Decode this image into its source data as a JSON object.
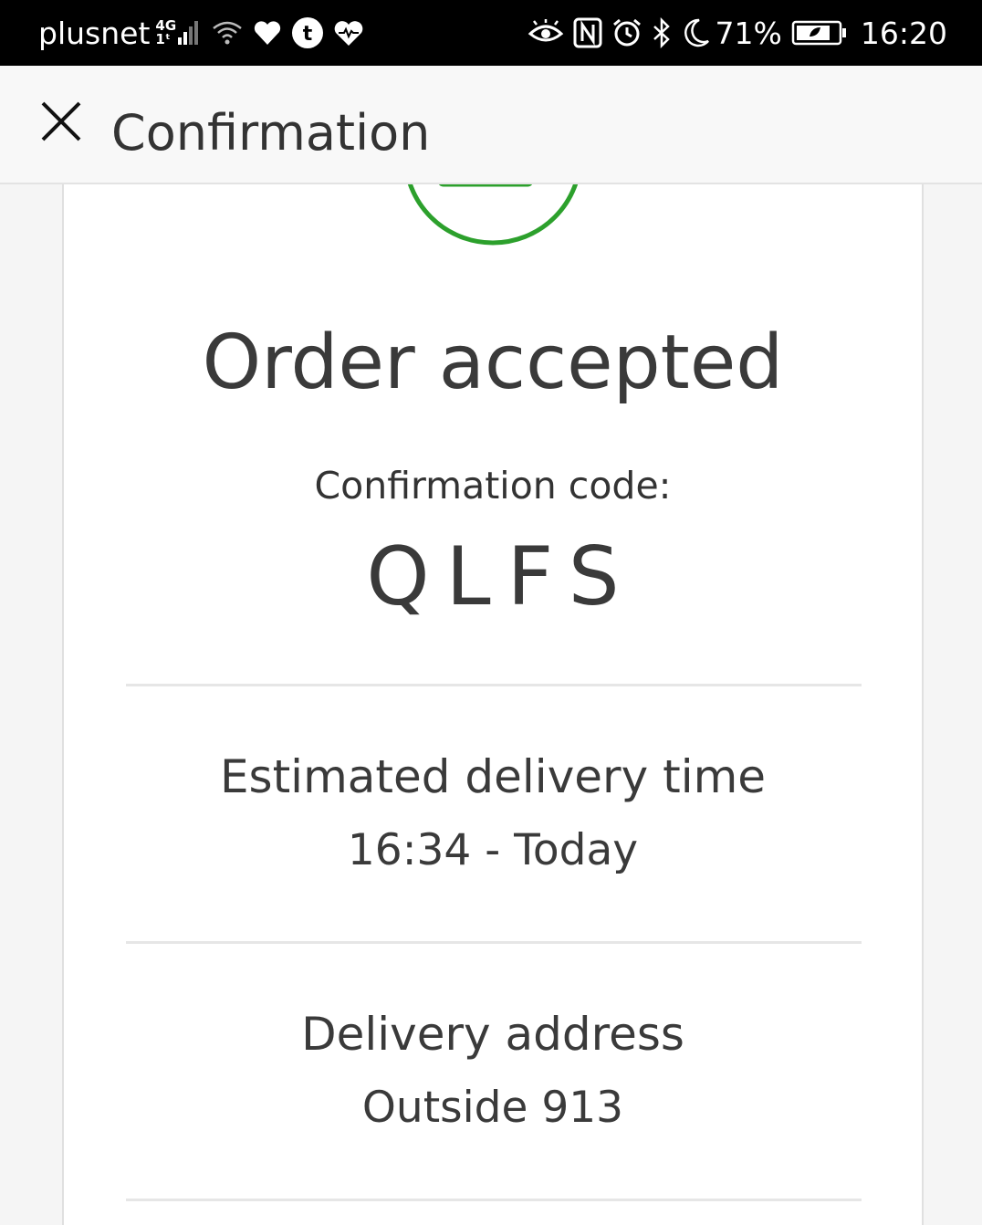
{
  "status_bar": {
    "carrier": "plusnet",
    "network_type_top": "4G",
    "network_type_bottom": "1ᵗ",
    "battery_percent": "71%",
    "time": "16:20",
    "icons": [
      "signal-icon",
      "wifi-icon",
      "heart-icon",
      "tumblr-icon",
      "health-icon",
      "eye-comfort-icon",
      "nfc-icon",
      "alarm-icon",
      "bluetooth-icon",
      "do-not-disturb-icon",
      "battery-icon"
    ]
  },
  "app_bar": {
    "title": "Confirmation",
    "close_icon": "close-icon"
  },
  "order": {
    "title": "Order accepted",
    "code_label": "Confirmation code:",
    "code_value": "QLFS"
  },
  "delivery_time": {
    "label": "Estimated delivery time",
    "value": "16:34 - Today"
  },
  "delivery_address": {
    "label": "Delivery address",
    "value": "Outside 913"
  },
  "colors": {
    "success_green": "#2ca02c",
    "text_dark": "#3a3a3a",
    "divider": "#e6e6e6"
  }
}
